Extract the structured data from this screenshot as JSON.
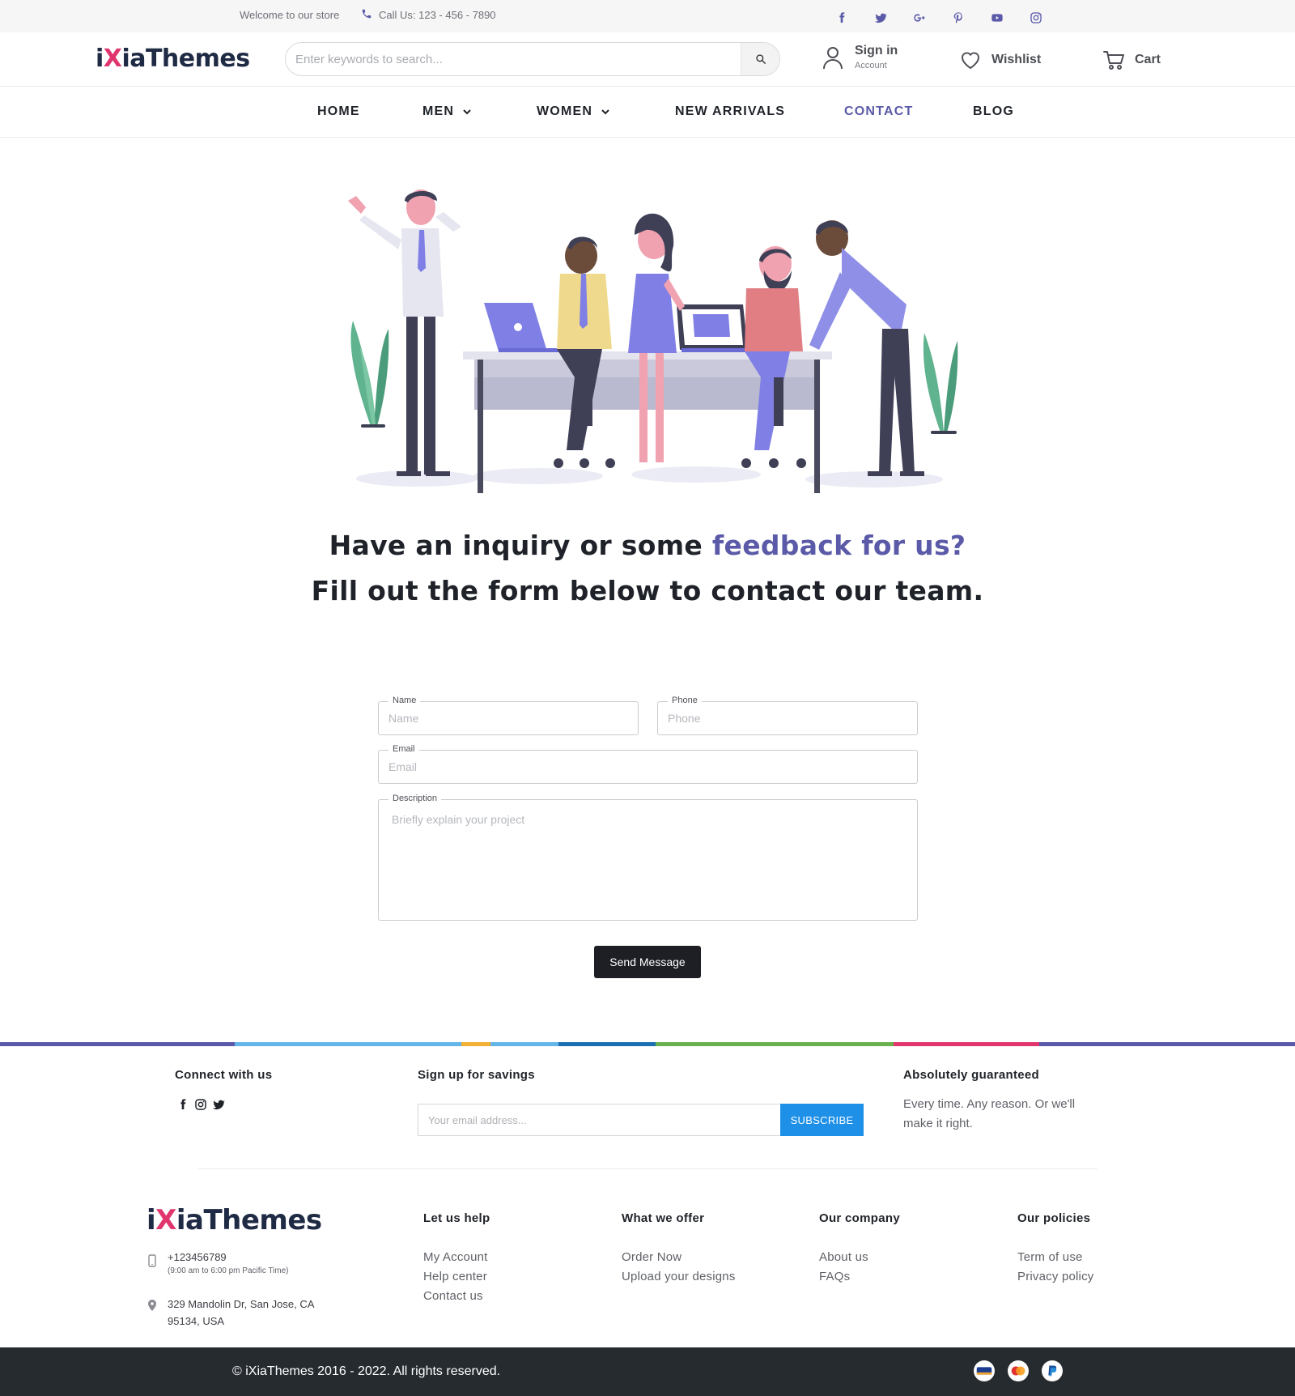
{
  "topbar": {
    "welcome": "Welcome to our store",
    "call": "Call Us: 123 - 456 - 7890",
    "social_icons": [
      "facebook-icon",
      "twitter-icon",
      "google-plus-icon",
      "pinterest-icon",
      "youtube-icon",
      "instagram-icon"
    ]
  },
  "header": {
    "logo_prefix": "i",
    "logo_x": "X",
    "logo_rest": "iaThemes",
    "search_placeholder": "Enter keywords to search...",
    "signin_label": "Sign in",
    "signin_sub": "Account",
    "wishlist_label": "Wishlist",
    "cart_label": "Cart"
  },
  "nav": {
    "items": [
      {
        "label": "HOME",
        "dropdown": false
      },
      {
        "label": "MEN",
        "dropdown": true
      },
      {
        "label": "WOMEN",
        "dropdown": true
      },
      {
        "label": "NEW ARRIVALS",
        "dropdown": false
      },
      {
        "label": "CONTACT",
        "dropdown": false,
        "active": true
      },
      {
        "label": "BLOG",
        "dropdown": false
      }
    ]
  },
  "hero": {
    "line1_start": "Have an inquiry or some ",
    "line1_accent": "feedback for us?",
    "line2": "Fill out the form below to contact our team."
  },
  "form": {
    "name_label": "Name",
    "name_placeholder": "Name",
    "phone_label": "Phone",
    "phone_placeholder": "Phone",
    "email_label": "Email",
    "email_placeholder": "Email",
    "desc_label": "Description",
    "desc_placeholder": "Briefly explain your project",
    "submit_label": "Send Message"
  },
  "footer": {
    "connect_heading": "Connect with us",
    "signup_heading": "Sign up for savings",
    "email_placeholder": "Your email address...",
    "subscribe_label": "SUBSCRIBE",
    "guarantee_heading": "Absolutely guaranteed",
    "guarantee_text": "Every time. Any reason. Or we'll make it right.",
    "logo_prefix": "i",
    "logo_x": "X",
    "logo_rest": "iaThemes",
    "phone": "+123456789",
    "hours": "(9:00 am to 6:00 pm Pacific Time)",
    "address_line1": "329 Mandolin Dr, San Jose, CA",
    "address_line2": "95134, USA",
    "columns": [
      {
        "heading": "Let us help",
        "links": [
          "My Account",
          "Help center",
          "Contact us"
        ]
      },
      {
        "heading": "What we offer",
        "links": [
          "Order Now",
          "Upload your designs"
        ]
      },
      {
        "heading": "Our company",
        "links": [
          "About us",
          "FAQs"
        ]
      },
      {
        "heading": "Our policies",
        "links": [
          "Term of use",
          "Privacy policy"
        ]
      }
    ],
    "copyright": "© iXiaThemes 2016 - 2022. All rights reserved.",
    "payment_icons": [
      "visa-icon",
      "mastercard-icon",
      "paypal-icon"
    ]
  },
  "colors": {
    "accent": "#5b5aa8",
    "logo_x": "#e0356d",
    "subscribe": "#1e90e8",
    "bottom_bar": "#262b30"
  }
}
